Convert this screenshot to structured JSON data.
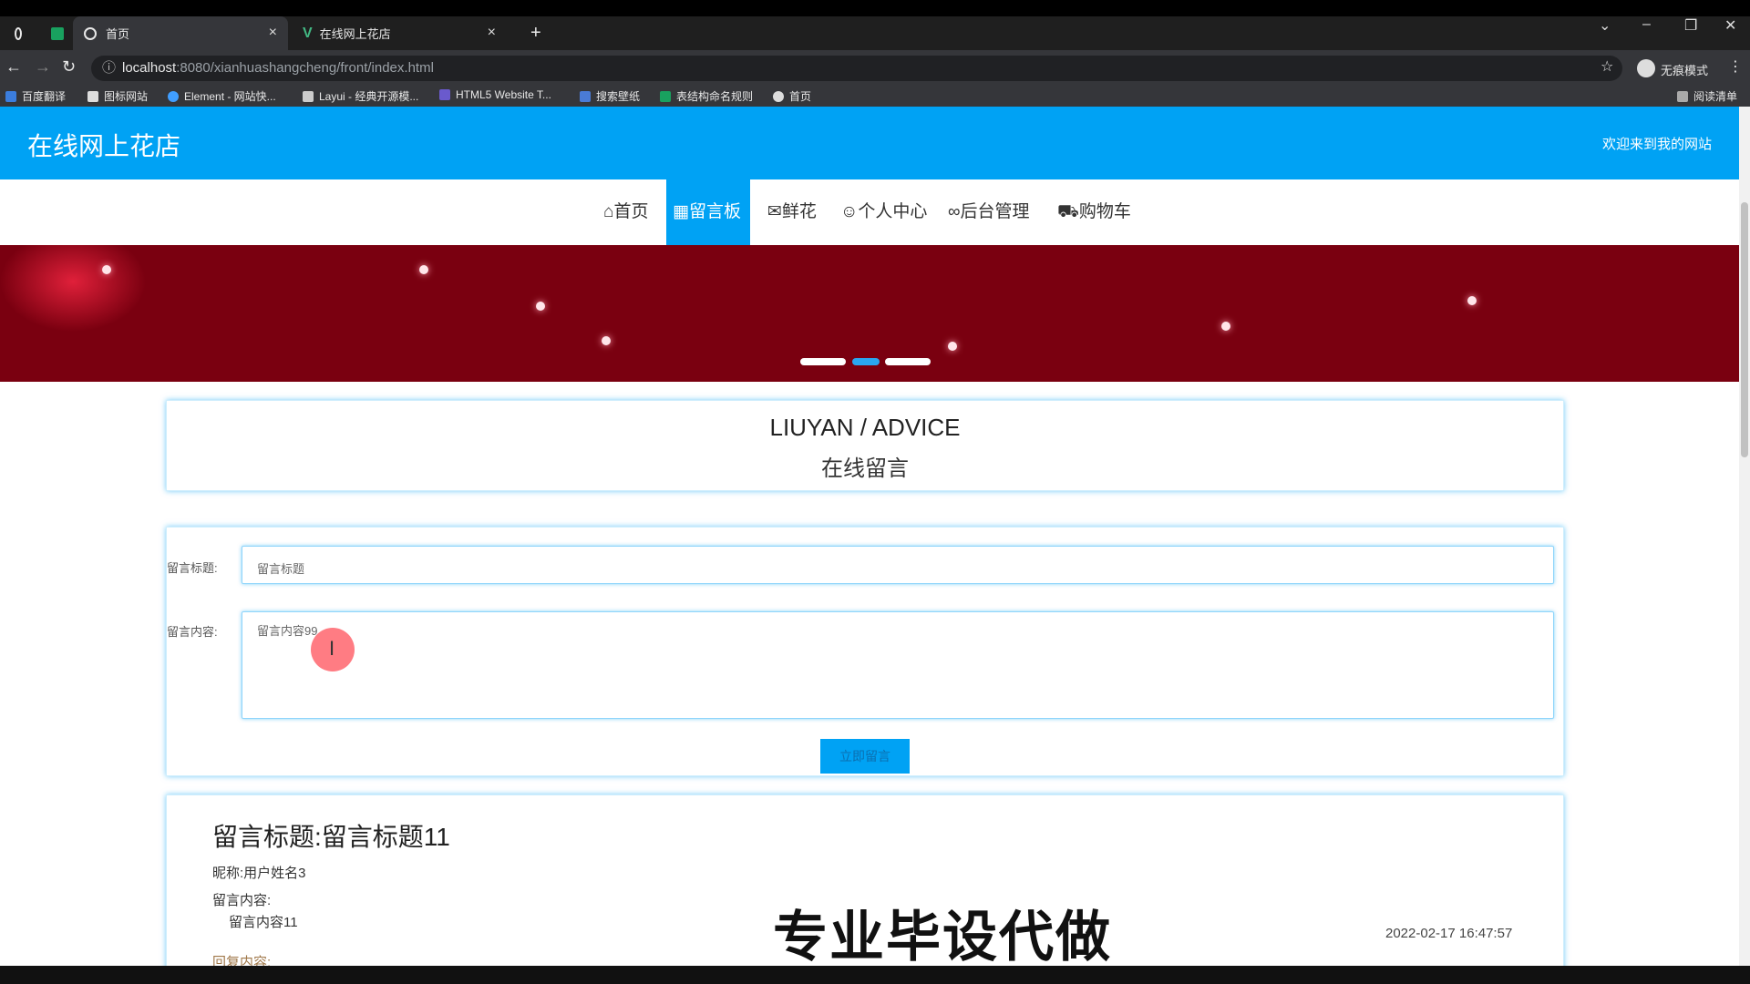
{
  "browser": {
    "tabs": [
      {
        "label": "首页",
        "active": true
      },
      {
        "label": "在线网上花店",
        "active": false
      }
    ],
    "new_tab": "+",
    "close": "×",
    "url_host": "localhost",
    "url_rest": ":8080/xianhuashangcheng/front/index.html",
    "profile_label": "无痕模式",
    "reading_list": "阅读清单",
    "bookmarks": [
      "百度翻译",
      "图标网站",
      "Element - 网站快...",
      "Layui - 经典开源模...",
      "HTML5 Website T...",
      "搜索壁纸",
      "表结构命名规则",
      "首页"
    ]
  },
  "header": {
    "site_title": "在线网上花店",
    "welcome": "欢迎来到我的网站"
  },
  "nav": {
    "items": [
      {
        "icon": "⌂",
        "label": "首页"
      },
      {
        "icon": "▦",
        "label": "留言板"
      },
      {
        "icon": "✉",
        "label": "鲜花"
      },
      {
        "icon": "☺",
        "label": "个人中心"
      },
      {
        "icon": "∞",
        "label": "后台管理"
      },
      {
        "icon": "⛟",
        "label": "购物车"
      }
    ],
    "active_index": 1
  },
  "advice": {
    "title": "LIUYAN / ADVICE",
    "subtitle": "在线留言"
  },
  "form": {
    "title_label": "留言标题:",
    "title_value": "留言标题",
    "content_label": "留言内容:",
    "content_value": "留言内容99",
    "submit_label": "立即留言"
  },
  "message": {
    "title": "留言标题:留言标题11",
    "nickname": "昵称:用户姓名3",
    "content_label": "留言内容:",
    "content": "留言内容11",
    "reply_label": "回复内容:",
    "date": "2022-02-17 16:47:57"
  },
  "watermark": "专业毕设代做",
  "colors": {
    "brand": "#00a2f4",
    "reply": "#a0784a"
  }
}
